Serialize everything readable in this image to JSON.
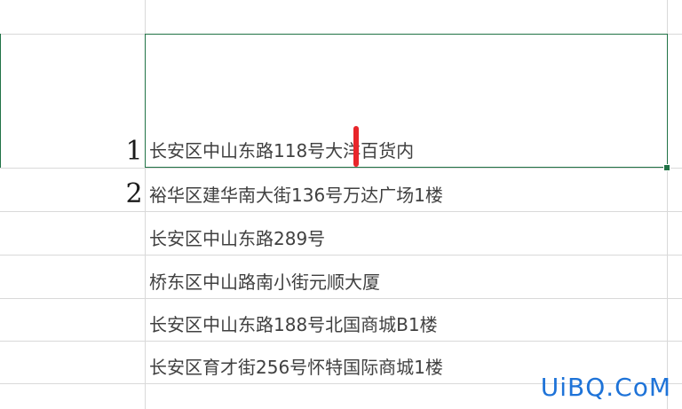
{
  "sheet": {
    "cells": [
      {
        "text": "长安区中山东路118号大洋百货内"
      },
      {
        "text": "裕华区建华南大街136号万达广场1楼"
      },
      {
        "text": "长安区中山东路289号"
      },
      {
        "text": "桥东区中山路南小街元顺大厦"
      },
      {
        "text": "长安区中山东路188号北国商城B1楼"
      },
      {
        "text": "长安区育才街256号怀特国际商城1楼"
      }
    ]
  },
  "annotations": {
    "marker_1": "1",
    "marker_2": "2"
  },
  "colors": {
    "selection_border": "#217346",
    "cursor_mark": "#e8252a",
    "watermark": "#1e73d8"
  },
  "watermark": "UiBQ.CoM"
}
